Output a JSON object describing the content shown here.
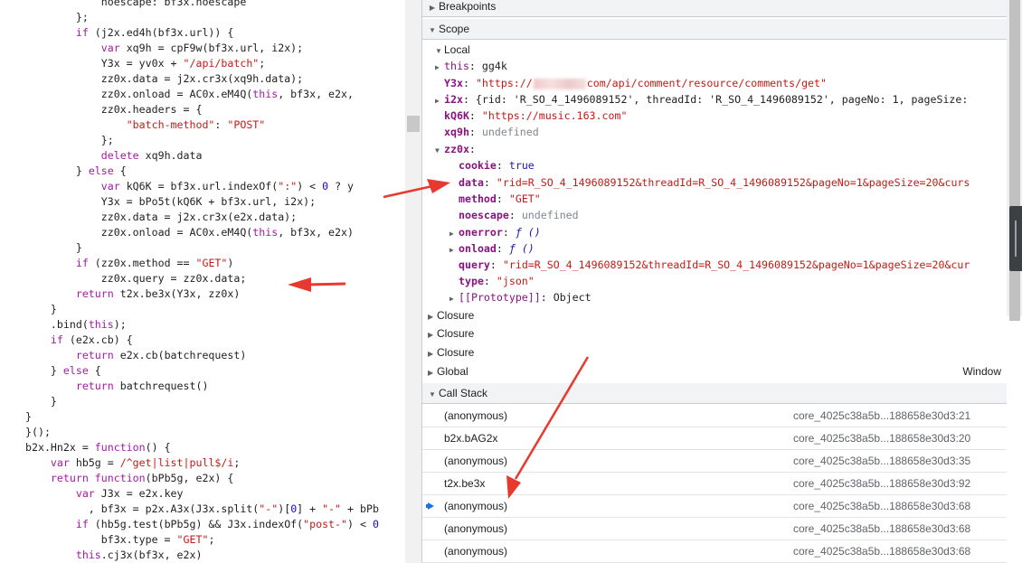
{
  "code": {
    "lines": [
      [
        {
          "t": "            noescape: bf3x.noescape",
          "c": "prop"
        }
      ],
      [
        {
          "t": "        };",
          "c": "punc"
        }
      ],
      [
        {
          "t": "        ",
          "c": "punc"
        },
        {
          "t": "if",
          "c": "kw"
        },
        {
          "t": " (j2x.ed4h(bf3x.url)) {",
          "c": "punc"
        }
      ],
      [
        {
          "t": "            ",
          "c": "punc"
        },
        {
          "t": "var",
          "c": "kw"
        },
        {
          "t": " xq9h = cpF9w(bf3x.url, i2x);",
          "c": "punc"
        }
      ],
      [
        {
          "t": "            Y3x = yv0x + ",
          "c": "punc"
        },
        {
          "t": "\"/api/batch\"",
          "c": "str"
        },
        {
          "t": ";",
          "c": "punc"
        }
      ],
      [
        {
          "t": "            zz0x.data = j2x.cr3x(xq9h.data);",
          "c": "punc"
        }
      ],
      [
        {
          "t": "            zz0x.onload = AC0x.eM4Q(",
          "c": "punc"
        },
        {
          "t": "this",
          "c": "kw"
        },
        {
          "t": ", bf3x, e2x,",
          "c": "punc"
        }
      ],
      [
        {
          "t": "            zz0x.headers = {",
          "c": "punc"
        }
      ],
      [
        {
          "t": "                ",
          "c": "punc"
        },
        {
          "t": "\"batch-method\"",
          "c": "str"
        },
        {
          "t": ": ",
          "c": "punc"
        },
        {
          "t": "\"POST\"",
          "c": "str"
        }
      ],
      [
        {
          "t": "            };",
          "c": "punc"
        }
      ],
      [
        {
          "t": "            ",
          "c": "punc"
        },
        {
          "t": "delete",
          "c": "kw"
        },
        {
          "t": " xq9h.data",
          "c": "punc"
        }
      ],
      [
        {
          "t": "        } ",
          "c": "punc"
        },
        {
          "t": "else",
          "c": "kw"
        },
        {
          "t": " {",
          "c": "punc"
        }
      ],
      [
        {
          "t": "            ",
          "c": "punc"
        },
        {
          "t": "var",
          "c": "kw"
        },
        {
          "t": " kQ6K = bf3x.url.indexOf(",
          "c": "punc"
        },
        {
          "t": "\":\"",
          "c": "str"
        },
        {
          "t": ") < ",
          "c": "punc"
        },
        {
          "t": "0",
          "c": "num"
        },
        {
          "t": " ? y",
          "c": "punc"
        }
      ],
      [
        {
          "t": "            Y3x = bPo5t(kQ6K + bf3x.url, i2x);",
          "c": "punc"
        }
      ],
      [
        {
          "t": "            zz0x.data = j2x.cr3x(e2x.data);",
          "c": "punc"
        }
      ],
      [
        {
          "t": "            zz0x.onload = AC0x.eM4Q(",
          "c": "punc"
        },
        {
          "t": "this",
          "c": "kw"
        },
        {
          "t": ", bf3x, e2x)",
          "c": "punc"
        }
      ],
      [
        {
          "t": "        }",
          "c": "punc"
        }
      ],
      [
        {
          "t": "        ",
          "c": "punc"
        },
        {
          "t": "if",
          "c": "kw"
        },
        {
          "t": " (zz0x.method == ",
          "c": "punc"
        },
        {
          "t": "\"GET\"",
          "c": "str"
        },
        {
          "t": ")",
          "c": "punc"
        }
      ],
      [
        {
          "t": "            zz0x.query = zz0x.data;",
          "c": "punc"
        }
      ],
      [
        {
          "t": "        ",
          "c": "punc"
        },
        {
          "t": "return",
          "c": "kw"
        },
        {
          "t": " t2x.be3x(Y3x, zz0x)",
          "c": "punc"
        }
      ],
      [
        {
          "t": "    }",
          "c": "punc"
        }
      ],
      [
        {
          "t": "    .bind(",
          "c": "punc"
        },
        {
          "t": "this",
          "c": "kw"
        },
        {
          "t": ");",
          "c": "punc"
        }
      ],
      [
        {
          "t": "    ",
          "c": "punc"
        },
        {
          "t": "if",
          "c": "kw"
        },
        {
          "t": " (e2x.cb) {",
          "c": "punc"
        }
      ],
      [
        {
          "t": "        ",
          "c": "punc"
        },
        {
          "t": "return",
          "c": "kw"
        },
        {
          "t": " e2x.cb(batchrequest)",
          "c": "punc"
        }
      ],
      [
        {
          "t": "    } ",
          "c": "punc"
        },
        {
          "t": "else",
          "c": "kw"
        },
        {
          "t": " {",
          "c": "punc"
        }
      ],
      [
        {
          "t": "        ",
          "c": "punc"
        },
        {
          "t": "return",
          "c": "kw"
        },
        {
          "t": " batchrequest()",
          "c": "punc"
        }
      ],
      [
        {
          "t": "    }",
          "c": "punc"
        }
      ],
      [
        {
          "t": "}",
          "c": "punc"
        }
      ],
      [
        {
          "t": "}();",
          "c": "punc"
        }
      ],
      [
        {
          "t": "b2x.Hn2x = ",
          "c": "punc"
        },
        {
          "t": "function",
          "c": "kw"
        },
        {
          "t": "() {",
          "c": "punc"
        }
      ],
      [
        {
          "t": "    ",
          "c": "punc"
        },
        {
          "t": "var",
          "c": "kw"
        },
        {
          "t": " hb5g = ",
          "c": "punc"
        },
        {
          "t": "/^get|list|pull$/i",
          "c": "str"
        },
        {
          "t": ";",
          "c": "punc"
        }
      ],
      [
        {
          "t": "    ",
          "c": "punc"
        },
        {
          "t": "return",
          "c": "kw"
        },
        {
          "t": " ",
          "c": "punc"
        },
        {
          "t": "function",
          "c": "kw"
        },
        {
          "t": "(bPb5g, e2x) {",
          "c": "punc"
        }
      ],
      [
        {
          "t": "        ",
          "c": "punc"
        },
        {
          "t": "var",
          "c": "kw"
        },
        {
          "t": " J3x = e2x.key",
          "c": "punc"
        }
      ],
      [
        {
          "t": "          , bf3x = p2x.A3x(J3x.split(",
          "c": "punc"
        },
        {
          "t": "\"-\"",
          "c": "str"
        },
        {
          "t": ")[",
          "c": "punc"
        },
        {
          "t": "0",
          "c": "num"
        },
        {
          "t": "] + ",
          "c": "punc"
        },
        {
          "t": "\"-\"",
          "c": "str"
        },
        {
          "t": " + bPb",
          "c": "punc"
        }
      ],
      [
        {
          "t": "        ",
          "c": "punc"
        },
        {
          "t": "if",
          "c": "kw"
        },
        {
          "t": " (hb5g.test(bPb5g) && J3x.indexOf(",
          "c": "punc"
        },
        {
          "t": "\"post-\"",
          "c": "str"
        },
        {
          "t": ") < ",
          "c": "punc"
        },
        {
          "t": "0",
          "c": "num"
        }
      ],
      [
        {
          "t": "            bf3x.type = ",
          "c": "punc"
        },
        {
          "t": "\"GET\"",
          "c": "str"
        },
        {
          "t": ";",
          "c": "punc"
        }
      ],
      [
        {
          "t": "        ",
          "c": "punc"
        },
        {
          "t": "this",
          "c": "kw"
        },
        {
          "t": ".cj3x(bf3x, e2x)",
          "c": "punc"
        }
      ],
      [
        {
          "t": "    }",
          "c": "punc"
        }
      ]
    ]
  },
  "breakpoints": {
    "label": "Breakpoints"
  },
  "scope": {
    "label": "Scope",
    "local_label": "Local",
    "this_key": "this",
    "this_val": "gg4k",
    "y3x_key": "Y3x",
    "y3x_prefix": "\"https://",
    "y3x_mid": "·  ·  1",
    "y3x_suffix": "com/api/comment/resource/comments/get\"",
    "i2x_key": "i2x",
    "i2x_val": "{rid: 'R_SO_4_1496089152', threadId: 'R_SO_4_1496089152', pageNo: 1, pageSize:",
    "kq6k_key": "kQ6K",
    "kq6k_val": "\"https://music.163.com\"",
    "xq9h_key": "xq9h",
    "xq9h_val": "undefined",
    "zz0x_key": "zz0x",
    "cookie_key": "cookie",
    "cookie_val": "true",
    "data_key": "data",
    "data_val": "\"rid=R_SO_4_1496089152&threadId=R_SO_4_1496089152&pageNo=1&pageSize=20&curs",
    "method_key": "method",
    "method_val": "\"GET\"",
    "noescape_key": "noescape",
    "noescape_val": "undefined",
    "onerror_key": "onerror",
    "onerror_val": "ƒ ()",
    "onload_key": "onload",
    "onload_val": "ƒ ()",
    "query_key": "query",
    "query_val": "\"rid=R_SO_4_1496089152&threadId=R_SO_4_1496089152&pageNo=1&pageSize=20&cur",
    "type_key": "type",
    "type_val": "\"json\"",
    "proto_key": "[[Prototype]]",
    "proto_val": "Object",
    "closure1": "Closure",
    "closure2": "Closure",
    "closure3": "Closure",
    "global": "Global",
    "global_val": "Window"
  },
  "call_stack": {
    "label": "Call Stack",
    "frames": [
      {
        "fn": "(anonymous)",
        "loc": "core_4025c38a5b...188658e30d3:21"
      },
      {
        "fn": "b2x.bAG2x",
        "loc": "core_4025c38a5b...188658e30d3:20"
      },
      {
        "fn": "(anonymous)",
        "loc": "core_4025c38a5b...188658e30d3:35"
      },
      {
        "fn": "t2x.be3x",
        "loc": "core_4025c38a5b...188658e30d3:92"
      },
      {
        "fn": "(anonymous)",
        "loc": "core_4025c38a5b...188658e30d3:68"
      },
      {
        "fn": "(anonymous)",
        "loc": "core_4025c38a5b...188658e30d3:68"
      },
      {
        "fn": "(anonymous)",
        "loc": "core_4025c38a5b...188658e30d3:68"
      }
    ]
  },
  "colors": {
    "annotation": "#e8392f",
    "current_frame": "#1a73e8"
  }
}
